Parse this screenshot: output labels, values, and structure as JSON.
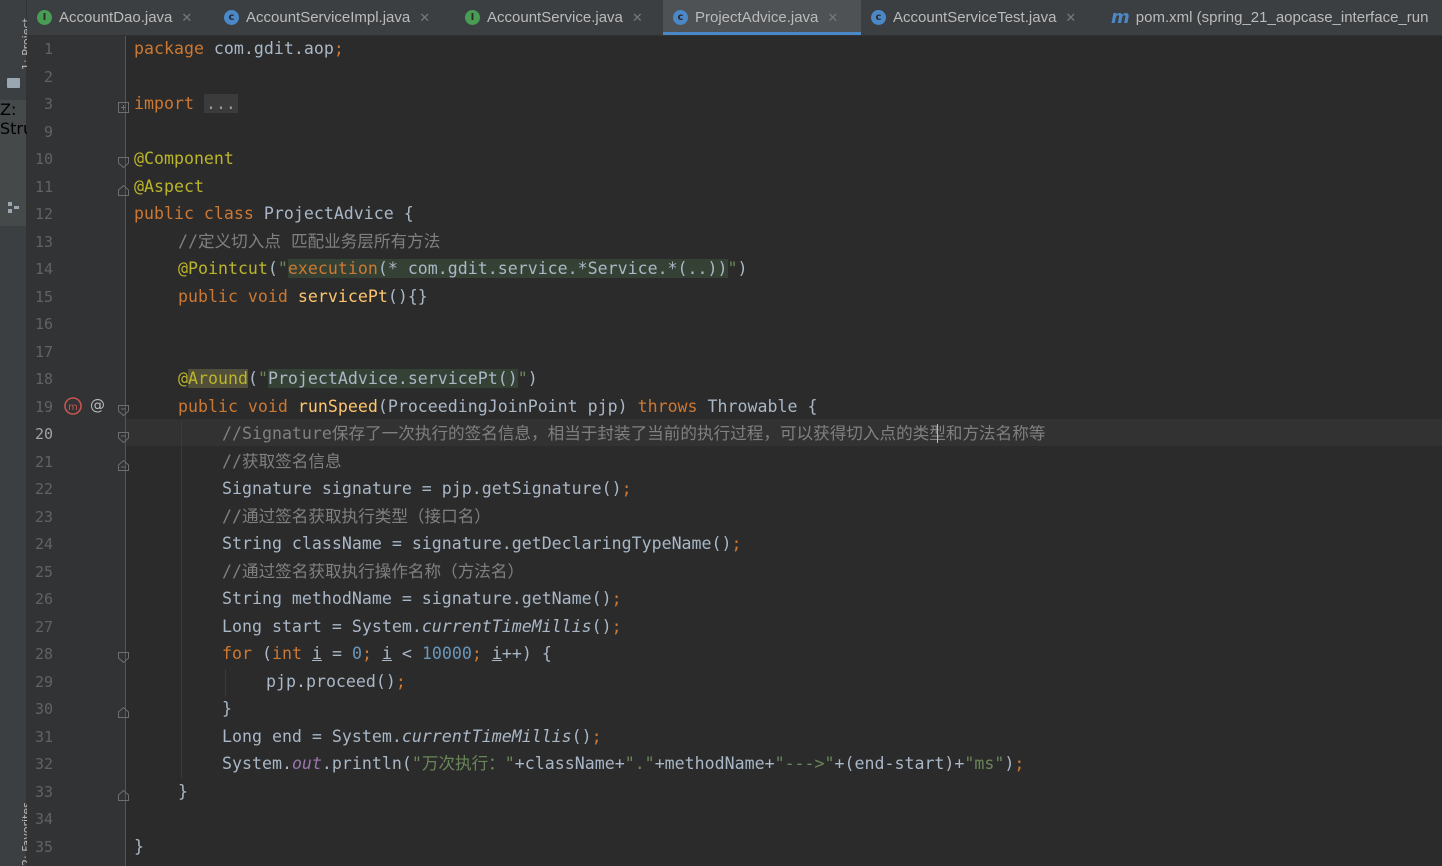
{
  "sidebar": {
    "project_label": "1: Project",
    "structure_label": "Z: Structure",
    "favorites_label": "2: Favorites"
  },
  "tabs": [
    {
      "label": "AccountDao.java",
      "icon": "interface-icon"
    },
    {
      "label": "AccountServiceImpl.java",
      "icon": "class-icon"
    },
    {
      "label": "AccountService.java",
      "icon": "interface-icon"
    },
    {
      "label": "ProjectAdvice.java",
      "icon": "class-icon",
      "active": true
    },
    {
      "label": "AccountServiceTest.java",
      "icon": "test-class-icon"
    },
    {
      "label": "pom.xml (spring_21_aopcase_interface_run",
      "icon": "maven-icon"
    }
  ],
  "editor": {
    "current_line": "20",
    "fold_placeholder": "...",
    "line_numbers": [
      "1",
      "2",
      "3",
      "9",
      "10",
      "11",
      "12",
      "13",
      "14",
      "15",
      "16",
      "17",
      "18",
      "19",
      "20",
      "21",
      "22",
      "23",
      "24",
      "25",
      "26",
      "27",
      "28",
      "29",
      "30",
      "31",
      "32",
      "33",
      "34",
      "35"
    ]
  },
  "code": {
    "l1": {
      "kw": "package",
      "rest": " com.gdit.aop",
      "semi": ";"
    },
    "l3": {
      "kw": "import"
    },
    "l10": "@Component",
    "l11": "@Aspect",
    "l12": {
      "kw": "public class",
      "rest": " ProjectAdvice {"
    },
    "l13": "//定义切入点 匹配业务层所有方法",
    "l14": {
      "ann": "@Pointcut",
      "p1": "(",
      "q1": "\"",
      "kw": "execution",
      "expr": "(* com.gdit.service.*Service.*(..))",
      "q2": "\"",
      "p2": ")"
    },
    "l15": {
      "kw": "public void",
      "fn": "servicePt",
      "rest": "(){}"
    },
    "l18": {
      "at": "@",
      "ann": "Around",
      "p1": "(",
      "q1": "\"",
      "expr": "ProjectAdvice.servicePt()",
      "q2": "\"",
      "p2": ")"
    },
    "l19": {
      "kw": "public void",
      "fn": "runSpeed",
      "args": "(ProceedingJoinPoint pjp) ",
      "throws": "throws",
      "rest": " Throwable {"
    },
    "l20": "//Signature保存了一次执行的签名信息，相当于封装了当前的执行过程，可以获得切入点的类型和方法名称等",
    "l21": "//获取签名信息",
    "l22": {
      "code": "Signature signature = pjp.getSignature()",
      "semi": ";"
    },
    "l23": "//通过签名获取执行类型（接口名）",
    "l24": {
      "code": "String className = signature.getDeclaringTypeName()",
      "semi": ";"
    },
    "l25": "//通过签名获取执行操作名称（方法名）",
    "l26": {
      "code": "String methodName = signature.getName()",
      "semi": ";"
    },
    "l27": {
      "code": "Long start = System.",
      "it": "currentTimeMillis",
      "rest": "()",
      "semi": ";"
    },
    "l28": {
      "kw": "for",
      "p": " (",
      "kw2": "int",
      "sp": " ",
      "v1": "i",
      "eq": " = ",
      "n1": "0",
      "semi1": ";",
      "sp2": " ",
      "v2": "i",
      "lt": " < ",
      "n2": "10000",
      "semi2": ";",
      "sp3": " ",
      "v3": "i",
      "rest": "++) {"
    },
    "l29": {
      "code": "pjp.proceed()",
      "semi": ";"
    },
    "l30": "}",
    "l31": {
      "code": "Long end = System.",
      "it": "currentTimeMillis",
      "rest": "()",
      "semi": ";"
    },
    "l32": {
      "a": "System.",
      "out": "out",
      "b": ".println(",
      "s1": "\"万次执行：\"",
      "c": "+className+",
      "s2": "\".\"",
      "d": "+methodName+",
      "s3": "\"--->\"",
      "e": "+(end-start)+",
      "s4": "\"ms\"",
      "f": ")",
      "semi": ";"
    },
    "l33": "}",
    "l35": "}"
  }
}
